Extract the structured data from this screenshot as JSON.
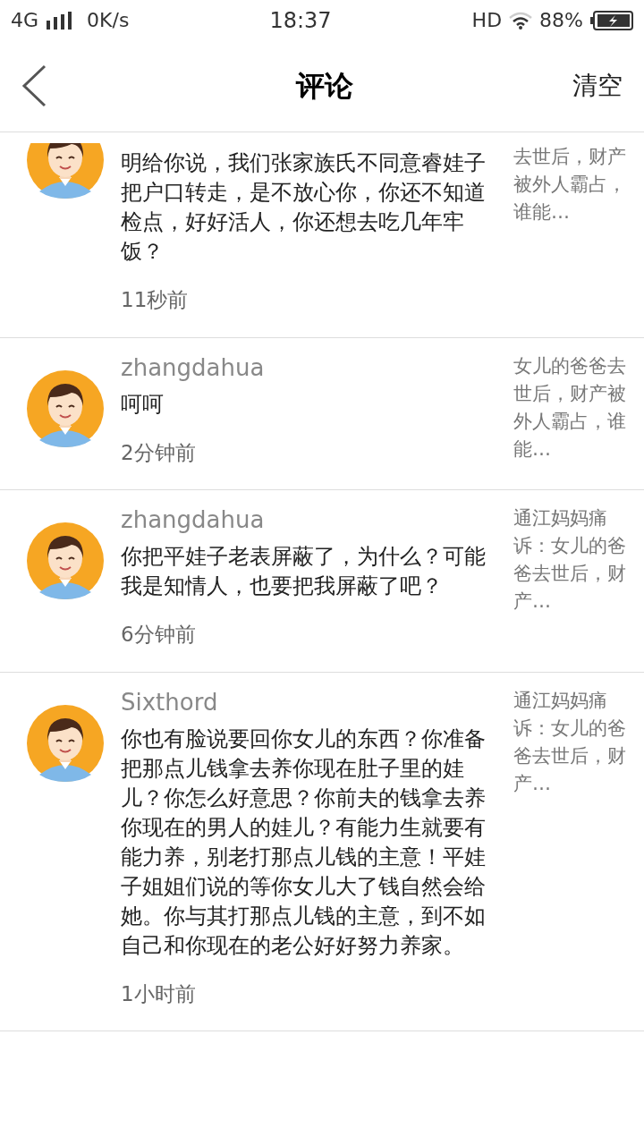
{
  "status_bar": {
    "network": "4G",
    "speed": "0K/s",
    "time": "18:37",
    "hd": "HD",
    "battery": "88%"
  },
  "header": {
    "title": "评论",
    "action": "清空"
  },
  "comments": [
    {
      "text": "明给你说，我们张家族氏不同意睿娃子把户口转走，是不放心你，你还不知道检点，好好活人，你还想去吃几年牢饭？",
      "time": "11秒前",
      "snippet": "去世后，财产被外人霸占，谁能…"
    },
    {
      "user": "zhangdahua",
      "text": "呵呵",
      "time": "2分钟前",
      "snippet": "女儿的爸爸去世后，财产被外人霸占，谁能…"
    },
    {
      "user": "zhangdahua",
      "text": "你把平娃子老表屏蔽了，为什么？可能我是知情人，也要把我屏蔽了吧？",
      "time": "6分钟前",
      "snippet": "通江妈妈痛诉：女儿的爸爸去世后，财产…"
    },
    {
      "user": "Sixthord",
      "text": "你也有脸说要回你女儿的东西？你准备把那点儿钱拿去养你现在肚子里的娃儿？你怎么好意思？你前夫的钱拿去养你现在的男人的娃儿？有能力生就要有能力养，别老打那点儿钱的主意！平娃子姐姐们说的等你女儿大了钱自然会给她。你与其打那点儿钱的主意，到不如自己和你现在的老公好好努力养家。",
      "time": "1小时前",
      "snippet": "通江妈妈痛诉：女儿的爸爸去世后，财产…"
    }
  ]
}
